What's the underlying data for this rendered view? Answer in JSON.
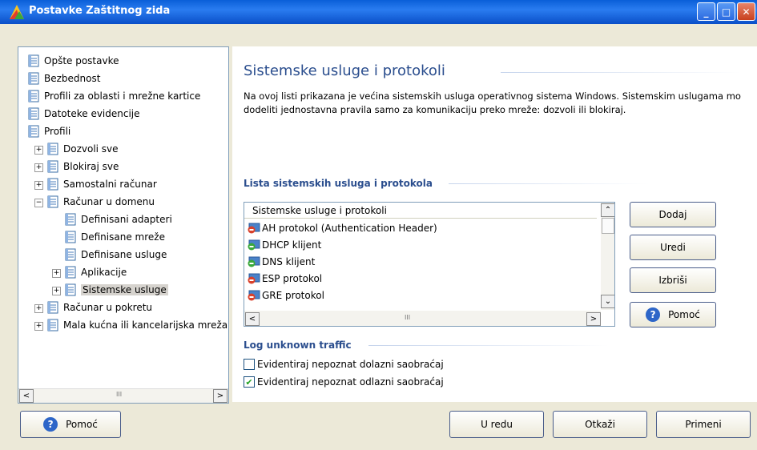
{
  "window": {
    "title": "Postavke Zaštitnog zida",
    "buttons": {
      "minimize": "_",
      "maximize": "□",
      "close": "✕"
    }
  },
  "tree": {
    "items": [
      {
        "label": "Opšte postavke",
        "level": 0,
        "expander": ""
      },
      {
        "label": "Bezbednost",
        "level": 0,
        "expander": ""
      },
      {
        "label": "Profili za oblasti i mrežne kartice",
        "level": 0,
        "expander": ""
      },
      {
        "label": "Datoteke evidencije",
        "level": 0,
        "expander": ""
      },
      {
        "label": "Profili",
        "level": 0,
        "expander": ""
      },
      {
        "label": "Dozvoli sve",
        "level": 1,
        "expander": "+"
      },
      {
        "label": "Blokiraj sve",
        "level": 1,
        "expander": "+"
      },
      {
        "label": "Samostalni računar",
        "level": 1,
        "expander": "+"
      },
      {
        "label": "Računar u domenu",
        "level": 1,
        "expander": "−"
      },
      {
        "label": "Definisani adapteri",
        "level": 2,
        "expander": ""
      },
      {
        "label": "Definisane mreže",
        "level": 2,
        "expander": ""
      },
      {
        "label": "Definisane usluge",
        "level": 2,
        "expander": ""
      },
      {
        "label": "Aplikacije",
        "level": 2,
        "expander": "+"
      },
      {
        "label": "Sistemske usluge",
        "level": 2,
        "expander": "+",
        "selected": true
      },
      {
        "label": "Računar u pokretu",
        "level": 1,
        "expander": "+"
      },
      {
        "label": "Mala kućna ili kancelarijska mreža",
        "level": 1,
        "expander": "+"
      }
    ],
    "scroll_marker": "III"
  },
  "main": {
    "title": "Sistemske usluge i protokoli",
    "description": "Na ovoj listi prikazana je većina sistemskih usluga operativnog sistema Windows. Sistemskim uslugama mo dodeliti jednostavna pravila samo za komunikaciju preko mreže: dozvoli ili blokiraj.",
    "list_section": "Lista sistemskih usluga i protokola",
    "list_header": "Sistemske usluge i protokoli",
    "list_rows": [
      {
        "label": "AH protokol (Authentication Header)",
        "status": "blocked"
      },
      {
        "label": "DHCP klijent",
        "status": "allowed"
      },
      {
        "label": "DNS klijent",
        "status": "allowed"
      },
      {
        "label": "ESP protokol",
        "status": "blocked"
      },
      {
        "label": "GRE protokol",
        "status": "blocked"
      }
    ],
    "list_scroll_marker": "III",
    "side_buttons": {
      "add": "Dodaj",
      "edit": "Uredi",
      "delete": "Izbriši",
      "help": "Pomoć"
    },
    "log_section": "Log unknown traffic",
    "checkboxes": [
      {
        "label": "Evidentiraj nepoznat dolazni saobraćaj",
        "checked": false
      },
      {
        "label": "Evidentiraj nepoznat odlazni saobraćaj",
        "checked": true
      }
    ]
  },
  "footer": {
    "help": "Pomoć",
    "ok": "U redu",
    "cancel": "Otkaži",
    "apply": "Primeni"
  },
  "colors": {
    "titlebar": "#0a5fd8",
    "section": "#2b4e8e",
    "blocked": "#d9412b",
    "allowed": "#39a83a"
  }
}
